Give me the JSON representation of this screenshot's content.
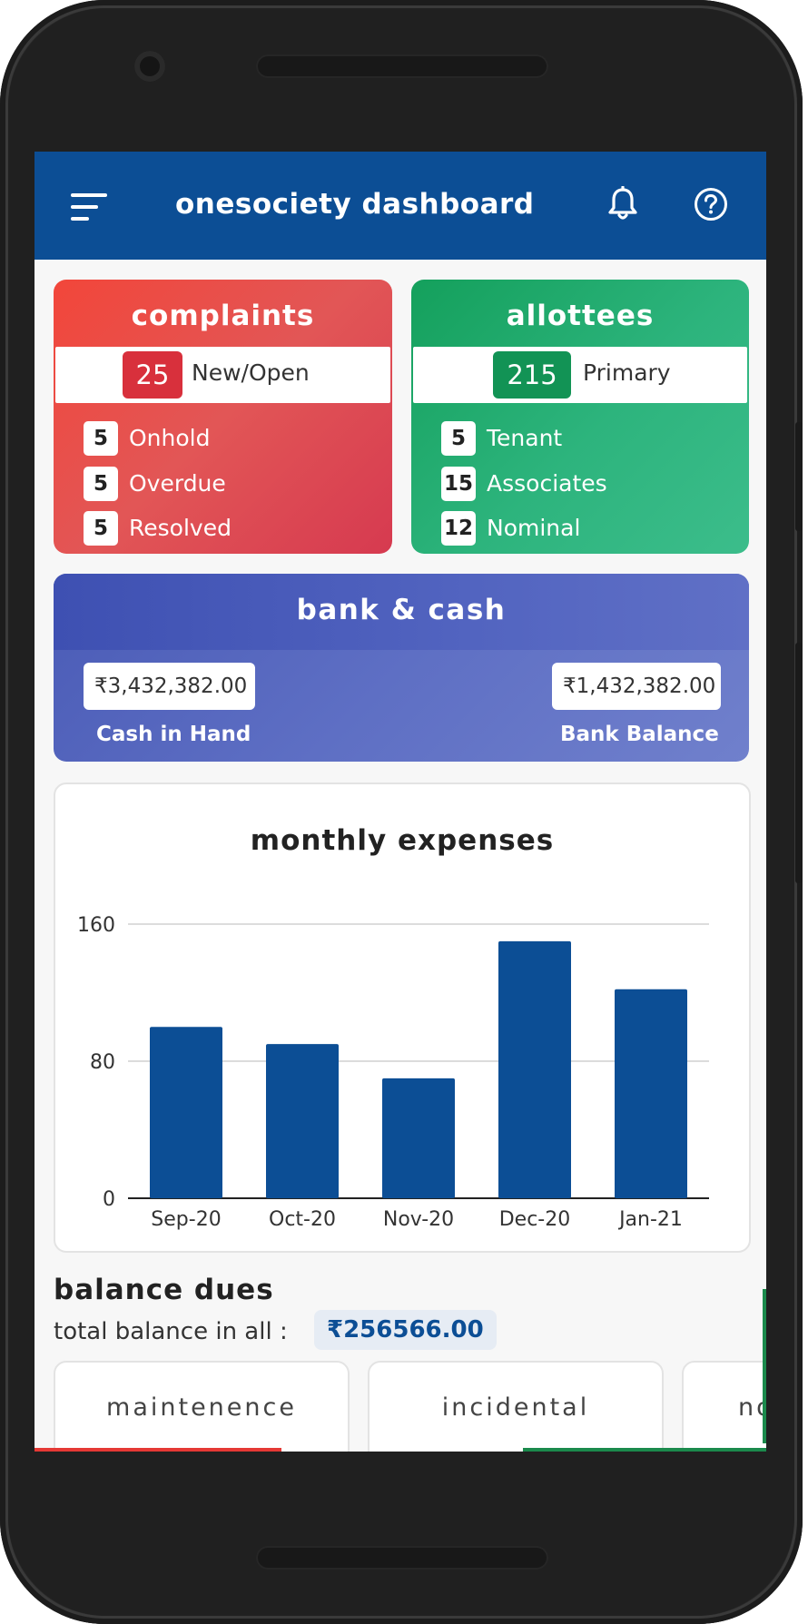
{
  "appbar": {
    "title": "onesociety dashboard",
    "menu_icon": "menu-icon",
    "notification_icon": "bell-icon",
    "help_icon": "help-icon"
  },
  "complaints": {
    "title": "complaints",
    "color": "#e6453e",
    "main": {
      "count": "25",
      "label": "New/Open"
    },
    "rows": [
      {
        "count": "5",
        "label": "Onhold"
      },
      {
        "count": "5",
        "label": "Overdue"
      },
      {
        "count": "5",
        "label": "Resolved"
      }
    ]
  },
  "allottees": {
    "title": "allottees",
    "color": "#1fa866",
    "main": {
      "count": "215",
      "label": "Primary"
    },
    "rows": [
      {
        "count": "5",
        "label": "Tenant"
      },
      {
        "count": "15",
        "label": "Associates"
      },
      {
        "count": "12",
        "label": "Nominal"
      }
    ]
  },
  "bank_cash": {
    "title": "bank & cash",
    "cash_in_hand": {
      "amount": "₹3,432,382.00",
      "label": "Cash in Hand"
    },
    "bank_balance": {
      "amount": "₹1,432,382.00",
      "label": "Bank Balance"
    }
  },
  "chart_data": {
    "type": "bar",
    "title": "monthly expenses",
    "categories": [
      "Sep-20",
      "Oct-20",
      "Nov-20",
      "Dec-20",
      "Jan-21"
    ],
    "values": [
      100,
      90,
      70,
      150,
      122
    ],
    "ylim": [
      0,
      160
    ],
    "yticks": [
      "0",
      "80",
      "160"
    ],
    "grid": true,
    "bar_color": "#0c4e95"
  },
  "balance_dues": {
    "title": "balance dues",
    "total_label": "total balance in all :",
    "total_value": "₹256566.00",
    "cards": [
      {
        "label": "maintenence",
        "accent": "#e53935"
      },
      {
        "label": "incidental",
        "accent": "#1b8a4c"
      },
      {
        "label": "no",
        "accent": "#1b8a4c"
      }
    ]
  }
}
